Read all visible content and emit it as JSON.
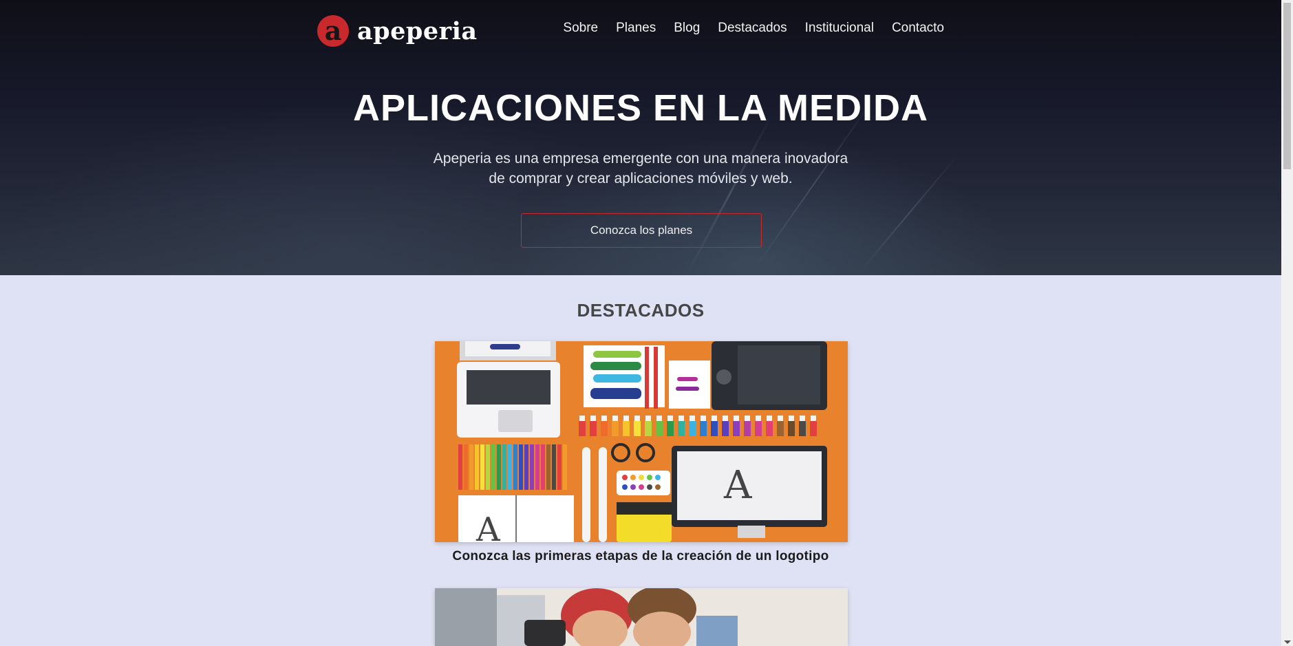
{
  "brand": {
    "name": "apeperia",
    "mark_letter": "a",
    "mark_color": "#c9282d"
  },
  "nav": {
    "items": [
      {
        "label": "Sobre"
      },
      {
        "label": "Planes"
      },
      {
        "label": "Blog"
      },
      {
        "label": "Destacados"
      },
      {
        "label": "Institucional"
      },
      {
        "label": "Contacto"
      }
    ]
  },
  "hero": {
    "title": "APLICACIONES EN LA MEDIDA",
    "description_line1": "Apeperia es una empresa emergente con una manera inovadora",
    "description_line2": "de comprar y crear aplicaciones móviles y web.",
    "cta_label": "Conozca los planes",
    "accent": "#c9282d"
  },
  "featured": {
    "title": "DESTACADOS",
    "cards": [
      {
        "caption": "Conozca las primeras etapas de la creación de un logotipo",
        "image_icon": "designer-desk-illustration"
      },
      {
        "caption": "",
        "image_icon": "people-photo"
      }
    ]
  },
  "colors": {
    "page_bg": "#dfe1f4",
    "card_bg": "#e9822d"
  }
}
